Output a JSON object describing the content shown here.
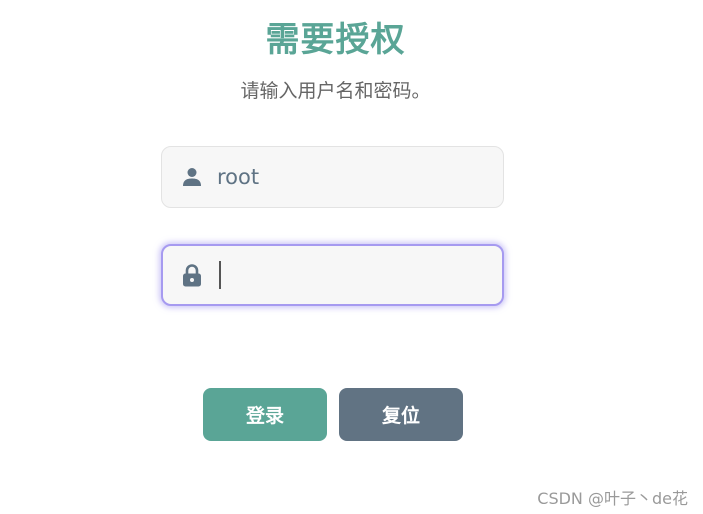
{
  "header": {
    "title": "需要授权",
    "subtitle": "请输入用户名和密码。"
  },
  "form": {
    "username": {
      "value": "root",
      "icon": "user-icon"
    },
    "password": {
      "value": "",
      "icon": "lock-icon",
      "focused": true
    }
  },
  "actions": {
    "login_label": "登录",
    "reset_label": "复位"
  },
  "watermark": "CSDN @叶子丶de花",
  "colors": {
    "accent": "#5aa596",
    "secondary_button": "#617383",
    "focus_ring": "#a69af0",
    "icon": "#5f7384"
  }
}
